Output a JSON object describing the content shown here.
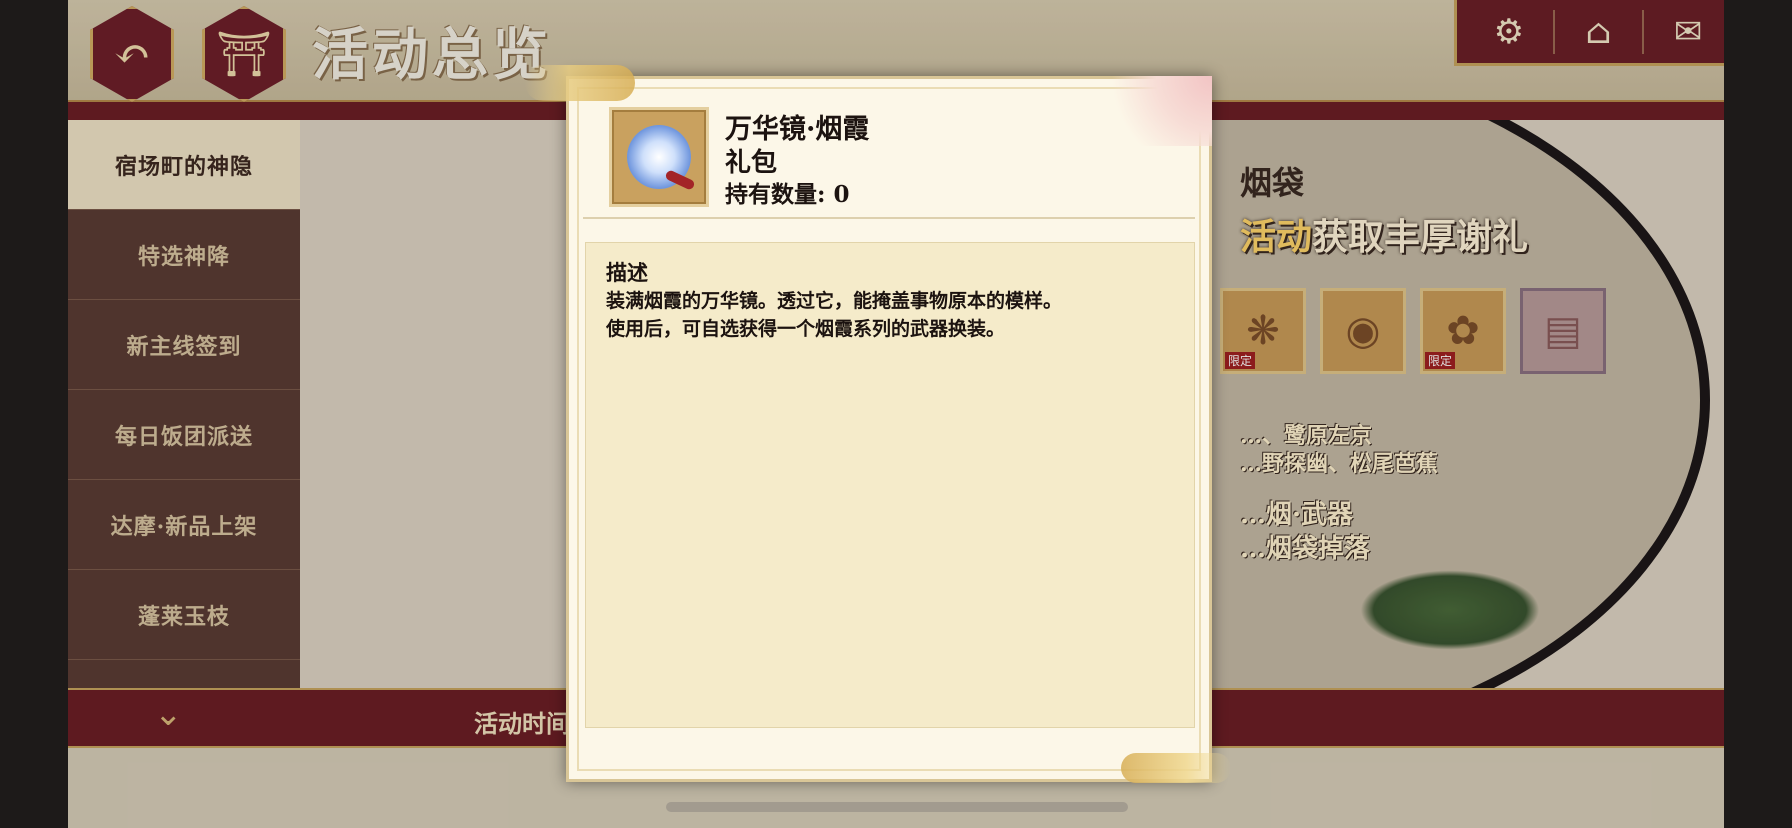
{
  "header": {
    "title": "活动总览",
    "back_icon": "↶",
    "gate_icon": "⛩",
    "right_icons": [
      "⚙",
      "⌂",
      "✉"
    ]
  },
  "sidebar": {
    "items": [
      {
        "label": "宿场町的神隐",
        "active": true
      },
      {
        "label": "特选神降",
        "active": false
      },
      {
        "label": "新主线签到",
        "active": false
      },
      {
        "label": "每日饭团派送",
        "active": false
      },
      {
        "label": "达摩·新品上架",
        "active": false
      },
      {
        "label": "蓬莱玉枝",
        "active": false
      }
    ]
  },
  "banner": {
    "line1": "烟袋",
    "line2_hl": "活动",
    "line2_rest": "获取丰厚谢礼",
    "line3a": "…、鹭原左京",
    "line3b": "…野探幽、松尾芭蕉",
    "line4a": "…烟·武器",
    "line4b": "…烟袋掉落",
    "rewards": [
      {
        "glyph": "❋",
        "tag": "限定",
        "pink": false
      },
      {
        "glyph": "◉",
        "tag": "",
        "pink": false
      },
      {
        "glyph": "✿",
        "tag": "限定",
        "pink": false
      },
      {
        "glyph": "▤",
        "tag": "",
        "pink": true
      }
    ]
  },
  "footer": {
    "time_label": "活动时间",
    "chevron": "⌄"
  },
  "dialog": {
    "item_name": "万华镜·烟霞",
    "item_type": "礼包",
    "count_label": "持有数量: 0",
    "desc_title": "描述",
    "desc_line1": "装满烟霞的万华镜。透过它，能掩盖事物原本的模样。",
    "desc_line2": "使用后，可自选获得一个烟霞系列的武器换装。"
  }
}
